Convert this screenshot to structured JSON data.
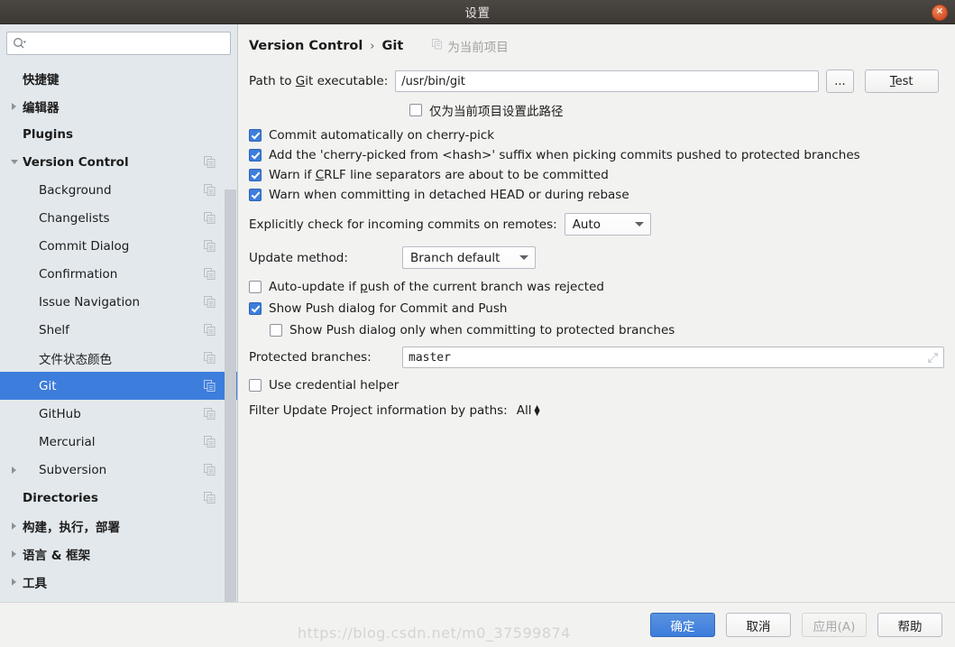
{
  "window": {
    "title": "设置",
    "close_label": "×"
  },
  "sidebar": {
    "search": {
      "value": "",
      "placeholder": ""
    },
    "items": [
      {
        "label": "快捷键",
        "indent": 0,
        "arrow": "none",
        "bold": true,
        "copy": false,
        "selected": false
      },
      {
        "label": "编辑器",
        "indent": 0,
        "arrow": "right",
        "bold": true,
        "copy": false,
        "selected": false
      },
      {
        "label": "Plugins",
        "indent": 0,
        "arrow": "none",
        "bold": true,
        "copy": false,
        "selected": false
      },
      {
        "label": "Version Control",
        "indent": 0,
        "arrow": "down",
        "bold": true,
        "copy": true,
        "selected": false
      },
      {
        "label": "Background",
        "indent": 1,
        "arrow": "none",
        "bold": false,
        "copy": true,
        "selected": false
      },
      {
        "label": "Changelists",
        "indent": 1,
        "arrow": "none",
        "bold": false,
        "copy": true,
        "selected": false
      },
      {
        "label": "Commit Dialog",
        "indent": 1,
        "arrow": "none",
        "bold": false,
        "copy": true,
        "selected": false
      },
      {
        "label": "Confirmation",
        "indent": 1,
        "arrow": "none",
        "bold": false,
        "copy": true,
        "selected": false
      },
      {
        "label": "Issue Navigation",
        "indent": 1,
        "arrow": "none",
        "bold": false,
        "copy": true,
        "selected": false
      },
      {
        "label": "Shelf",
        "indent": 1,
        "arrow": "none",
        "bold": false,
        "copy": true,
        "selected": false
      },
      {
        "label": "文件状态颜色",
        "indent": 1,
        "arrow": "none",
        "bold": false,
        "copy": true,
        "selected": false
      },
      {
        "label": "Git",
        "indent": 1,
        "arrow": "none",
        "bold": false,
        "copy": true,
        "selected": true
      },
      {
        "label": "GitHub",
        "indent": 1,
        "arrow": "none",
        "bold": false,
        "copy": true,
        "selected": false
      },
      {
        "label": "Mercurial",
        "indent": 1,
        "arrow": "none",
        "bold": false,
        "copy": true,
        "selected": false
      },
      {
        "label": "Subversion",
        "indent": 1,
        "arrow": "right",
        "bold": false,
        "copy": true,
        "selected": false
      },
      {
        "label": "Directories",
        "indent": 0,
        "arrow": "none",
        "bold": true,
        "copy": true,
        "selected": false
      },
      {
        "label": "构建，执行，部署",
        "indent": 0,
        "arrow": "right",
        "bold": true,
        "copy": false,
        "selected": false
      },
      {
        "label": "语言 & 框架",
        "indent": 0,
        "arrow": "right",
        "bold": true,
        "copy": false,
        "selected": false
      },
      {
        "label": "工具",
        "indent": 0,
        "arrow": "right",
        "bold": true,
        "copy": false,
        "selected": false
      }
    ]
  },
  "main": {
    "breadcrumb": {
      "parent": "Version Control",
      "separator": "›",
      "current": "Git"
    },
    "for_current_project": "为当前项目",
    "path_label_pre": "Path to ",
    "path_label_key": "G",
    "path_label_post": "it executable:",
    "path_value": "/usr/bin/git",
    "browse_label": "...",
    "test_key": "T",
    "test_label_post": "est",
    "project_only_path_label": "仅为当前项目设置此路径",
    "project_only_path_checked": false,
    "checkboxes": [
      {
        "label": "Commit automatically on cherry-pick",
        "checked": true,
        "indent": 0
      },
      {
        "label": "Add the 'cherry-picked from <hash>' suffix when picking commits pushed to protected branches",
        "checked": true,
        "indent": 0
      },
      {
        "label_pre": "Warn if ",
        "label_key": "C",
        "label_post": "RLF line separators are about to be committed",
        "checked": true,
        "indent": 0
      },
      {
        "label": "Warn when committing in detached HEAD or during rebase",
        "checked": true,
        "indent": 0
      }
    ],
    "incoming_label": "Explicitly check for incoming commits on remotes:",
    "incoming_value": "Auto",
    "update_method_label": "Update method:",
    "update_method_value": "Branch default",
    "auto_update_pre": "Auto-update if ",
    "auto_update_key": "p",
    "auto_update_post": "ush of the current branch was rejected",
    "auto_update_checked": false,
    "show_push_label": "Show Push dialog for Commit and Push",
    "show_push_checked": true,
    "show_push_protected_label": "Show Push dialog only when committing to protected branches",
    "show_push_protected_checked": false,
    "protected_branches_label": "Protected branches:",
    "protected_branches_value": "master",
    "use_credential_label": "Use credential helper",
    "use_credential_checked": false,
    "filter_label": "Filter Update Project information by paths:",
    "filter_value": "All"
  },
  "footer": {
    "ok": "确定",
    "cancel": "取消",
    "apply": "应用(A)",
    "help": "帮助",
    "watermark": "https://blog.csdn.net/m0_37599874"
  }
}
